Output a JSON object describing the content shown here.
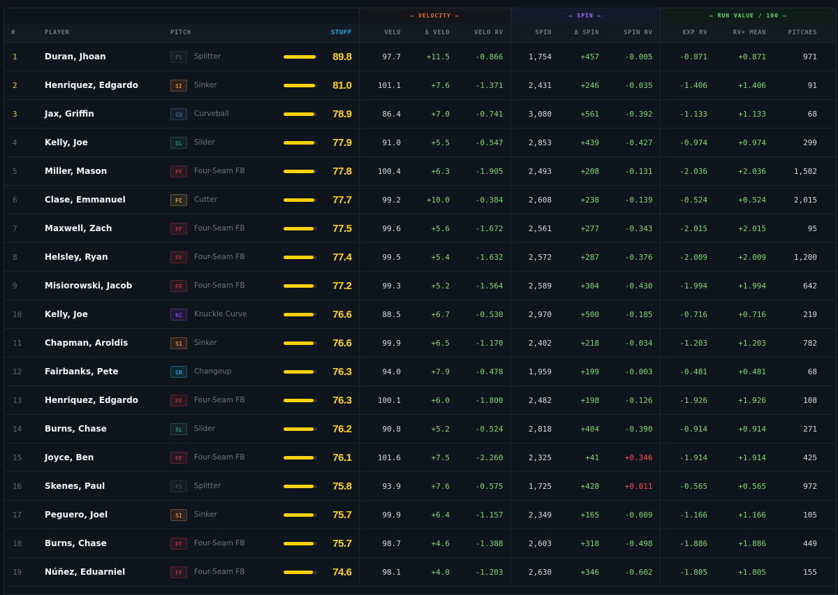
{
  "groups": {
    "velocity": "— VELOCITY —",
    "spin": "— SPIN —",
    "run_value": "— RUN VALUE / 100 —"
  },
  "columns": {
    "rank": "#",
    "player": "PLAYER",
    "pitch": "PITCH",
    "stuff": "STUFF",
    "velo": "VELO",
    "dvelo": "Δ VELO",
    "velo_rv": "VELO RV",
    "spin": "SPIN",
    "dspin": "Δ SPIN",
    "spin_rv": "SPIN RV",
    "exp_rv": "EXP RV",
    "rv_mean": "RV+ MEAN",
    "pitches": "PITCHES"
  },
  "colors": {
    "FS": "#3a4a5a",
    "SI": "#d9823a",
    "CU": "#3d6f9e",
    "SL": "#2d8a78",
    "FF": "#b8323a",
    "FC": "#d2a040",
    "KC": "#8a3ed6",
    "CH": "#1fa3d0"
  },
  "rows": [
    {
      "rank": "1",
      "player": "Duran, Jhoan",
      "code": "FS",
      "pitch": "Splitter",
      "stuff": "89.8",
      "bar": 0.95,
      "velo": "97.7",
      "dvelo": "+11.5",
      "velo_rv": "-0.866",
      "spin": "1,754",
      "dspin": "+457",
      "spin_rv": "-0.005",
      "exp_rv": "-0.871",
      "rv_mean": "+0.871",
      "pitches": "971"
    },
    {
      "rank": "2",
      "player": "Henriquez, Edgardo",
      "code": "SI",
      "pitch": "Sinker",
      "stuff": "81.0",
      "bar": 0.93,
      "velo": "101.1",
      "dvelo": "+7.6",
      "velo_rv": "-1.371",
      "spin": "2,431",
      "dspin": "+246",
      "spin_rv": "-0.035",
      "exp_rv": "-1.406",
      "rv_mean": "+1.406",
      "pitches": "91"
    },
    {
      "rank": "3",
      "player": "Jax, Griffin",
      "code": "CU",
      "pitch": "Curveball",
      "stuff": "78.9",
      "bar": 0.92,
      "velo": "86.4",
      "dvelo": "+7.0",
      "velo_rv": "-0.741",
      "spin": "3,080",
      "dspin": "+561",
      "spin_rv": "-0.392",
      "exp_rv": "-1.133",
      "rv_mean": "+1.133",
      "pitches": "68"
    },
    {
      "rank": "4",
      "player": "Kelly, Joe",
      "code": "SL",
      "pitch": "Slider",
      "stuff": "77.9",
      "bar": 0.91,
      "velo": "91.0",
      "dvelo": "+5.5",
      "velo_rv": "-0.547",
      "spin": "2,853",
      "dspin": "+439",
      "spin_rv": "-0.427",
      "exp_rv": "-0.974",
      "rv_mean": "+0.974",
      "pitches": "299"
    },
    {
      "rank": "5",
      "player": "Miller, Mason",
      "code": "FF",
      "pitch": "Four-Seam FB",
      "stuff": "77.8",
      "bar": 0.91,
      "velo": "100.4",
      "dvelo": "+6.3",
      "velo_rv": "-1.905",
      "spin": "2,493",
      "dspin": "+208",
      "spin_rv": "-0.131",
      "exp_rv": "-2.036",
      "rv_mean": "+2.036",
      "pitches": "1,502"
    },
    {
      "rank": "6",
      "player": "Clase, Emmanuel",
      "code": "FC",
      "pitch": "Cutter",
      "stuff": "77.7",
      "bar": 0.91,
      "velo": "99.2",
      "dvelo": "+10.0",
      "velo_rv": "-0.384",
      "spin": "2,608",
      "dspin": "+238",
      "spin_rv": "-0.139",
      "exp_rv": "-0.524",
      "rv_mean": "+0.524",
      "pitches": "2,015"
    },
    {
      "rank": "7",
      "player": "Maxwell, Zach",
      "code": "FF",
      "pitch": "Four-Seam FB",
      "stuff": "77.5",
      "bar": 0.9,
      "velo": "99.6",
      "dvelo": "+5.6",
      "velo_rv": "-1.672",
      "spin": "2,561",
      "dspin": "+277",
      "spin_rv": "-0.343",
      "exp_rv": "-2.015",
      "rv_mean": "+2.015",
      "pitches": "95"
    },
    {
      "rank": "8",
      "player": "Helsley, Ryan",
      "code": "FF",
      "pitch": "Four-Seam FB",
      "stuff": "77.4",
      "bar": 0.9,
      "velo": "99.5",
      "dvelo": "+5.4",
      "velo_rv": "-1.632",
      "spin": "2,572",
      "dspin": "+287",
      "spin_rv": "-0.376",
      "exp_rv": "-2.009",
      "rv_mean": "+2.009",
      "pitches": "1,200"
    },
    {
      "rank": "9",
      "player": "Misiorowski, Jacob",
      "code": "FF",
      "pitch": "Four-Seam FB",
      "stuff": "77.2",
      "bar": 0.9,
      "velo": "99.3",
      "dvelo": "+5.2",
      "velo_rv": "-1.564",
      "spin": "2,589",
      "dspin": "+304",
      "spin_rv": "-0.430",
      "exp_rv": "-1.994",
      "rv_mean": "+1.994",
      "pitches": "642"
    },
    {
      "rank": "10",
      "player": "Kelly, Joe",
      "code": "KC",
      "pitch": "Knuckle Curve",
      "stuff": "76.6",
      "bar": 0.89,
      "velo": "88.5",
      "dvelo": "+6.7",
      "velo_rv": "-0.530",
      "spin": "2,970",
      "dspin": "+500",
      "spin_rv": "-0.185",
      "exp_rv": "-0.716",
      "rv_mean": "+0.716",
      "pitches": "219"
    },
    {
      "rank": "11",
      "player": "Chapman, Aroldis",
      "code": "SI",
      "pitch": "Sinker",
      "stuff": "76.6",
      "bar": 0.89,
      "velo": "99.9",
      "dvelo": "+6.5",
      "velo_rv": "-1.170",
      "spin": "2,402",
      "dspin": "+218",
      "spin_rv": "-0.034",
      "exp_rv": "-1.203",
      "rv_mean": "+1.203",
      "pitches": "782"
    },
    {
      "rank": "12",
      "player": "Fairbanks, Pete",
      "code": "CH",
      "pitch": "Changeup",
      "stuff": "76.3",
      "bar": 0.89,
      "velo": "94.0",
      "dvelo": "+7.9",
      "velo_rv": "-0.478",
      "spin": "1,959",
      "dspin": "+199",
      "spin_rv": "-0.003",
      "exp_rv": "-0.481",
      "rv_mean": "+0.481",
      "pitches": "68"
    },
    {
      "rank": "13",
      "player": "Henriquez, Edgardo",
      "code": "FF",
      "pitch": "Four-Seam FB",
      "stuff": "76.3",
      "bar": 0.89,
      "velo": "100.1",
      "dvelo": "+6.0",
      "velo_rv": "-1.800",
      "spin": "2,482",
      "dspin": "+198",
      "spin_rv": "-0.126",
      "exp_rv": "-1.926",
      "rv_mean": "+1.926",
      "pitches": "108"
    },
    {
      "rank": "14",
      "player": "Burns, Chase",
      "code": "SL",
      "pitch": "Slider",
      "stuff": "76.2",
      "bar": 0.89,
      "velo": "90.8",
      "dvelo": "+5.2",
      "velo_rv": "-0.524",
      "spin": "2,818",
      "dspin": "+404",
      "spin_rv": "-0.390",
      "exp_rv": "-0.914",
      "rv_mean": "+0.914",
      "pitches": "271"
    },
    {
      "rank": "15",
      "player": "Joyce, Ben",
      "code": "FF",
      "pitch": "Four-Seam FB",
      "stuff": "76.1",
      "bar": 0.89,
      "velo": "101.6",
      "dvelo": "+7.5",
      "velo_rv": "-2.260",
      "spin": "2,325",
      "dspin": "+41",
      "spin_rv": "+0.346",
      "spin_rv_red": true,
      "exp_rv": "-1.914",
      "rv_mean": "+1.914",
      "pitches": "425"
    },
    {
      "rank": "16",
      "player": "Skenes, Paul",
      "code": "FS",
      "pitch": "Splitter",
      "stuff": "75.8",
      "bar": 0.88,
      "velo": "93.9",
      "dvelo": "+7.6",
      "velo_rv": "-0.575",
      "spin": "1,725",
      "dspin": "+428",
      "spin_rv": "+0.011",
      "spin_rv_red": true,
      "exp_rv": "-0.565",
      "rv_mean": "+0.565",
      "pitches": "972"
    },
    {
      "rank": "17",
      "player": "Peguero, Joel",
      "code": "SI",
      "pitch": "Sinker",
      "stuff": "75.7",
      "bar": 0.88,
      "velo": "99.9",
      "dvelo": "+6.4",
      "velo_rv": "-1.157",
      "spin": "2,349",
      "dspin": "+165",
      "spin_rv": "-0.009",
      "exp_rv": "-1.166",
      "rv_mean": "+1.166",
      "pitches": "105"
    },
    {
      "rank": "18",
      "player": "Burns, Chase",
      "code": "FF",
      "pitch": "Four-Seam FB",
      "stuff": "75.7",
      "bar": 0.88,
      "velo": "98.7",
      "dvelo": "+4.6",
      "velo_rv": "-1.388",
      "spin": "2,603",
      "dspin": "+318",
      "spin_rv": "-0.498",
      "exp_rv": "-1.886",
      "rv_mean": "+1.886",
      "pitches": "449"
    },
    {
      "rank": "19",
      "player": "Núñez, Eduarniel",
      "code": "FF",
      "pitch": "Four-Seam FB",
      "stuff": "74.6",
      "bar": 0.86,
      "velo": "98.1",
      "dvelo": "+4.0",
      "velo_rv": "-1.203",
      "spin": "2,630",
      "dspin": "+346",
      "spin_rv": "-0.602",
      "exp_rv": "-1.805",
      "rv_mean": "+1.805",
      "pitches": "155"
    }
  ]
}
